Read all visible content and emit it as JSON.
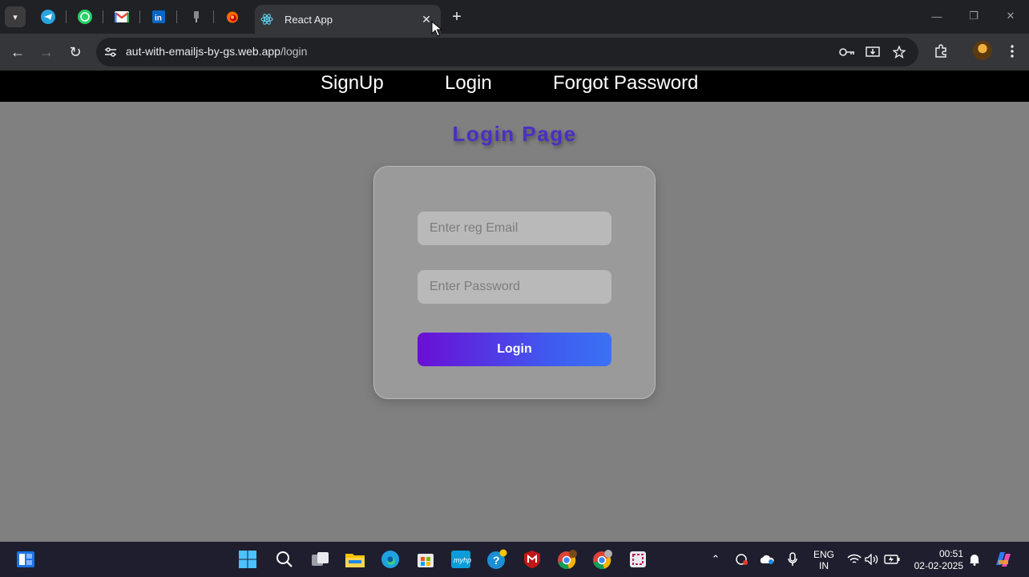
{
  "browser": {
    "active_tab_title": "React App",
    "url_host": "aut-with-emailjs-by-gs.web.app",
    "url_path": "/login",
    "pinned_tabs": [
      "telegram-icon",
      "whatsapp-icon",
      "gmail-icon",
      "linkedin-icon",
      "pin-icon",
      "firefox-icon"
    ]
  },
  "nav": {
    "signup": "SignUp",
    "login": "Login",
    "forgot": "Forgot Password"
  },
  "page": {
    "title": "Login Page",
    "email_placeholder": "Enter reg Email",
    "password_placeholder": "Enter Password",
    "login_button": "Login"
  },
  "taskbar": {
    "lang_1": "ENG",
    "lang_2": "IN",
    "time": "00:51",
    "date": "02-02-2025"
  },
  "colors": {
    "page_bg": "#808080",
    "title": "#4a2fc4",
    "button_start": "#6a0fd6",
    "button_end": "#3a72f4"
  }
}
